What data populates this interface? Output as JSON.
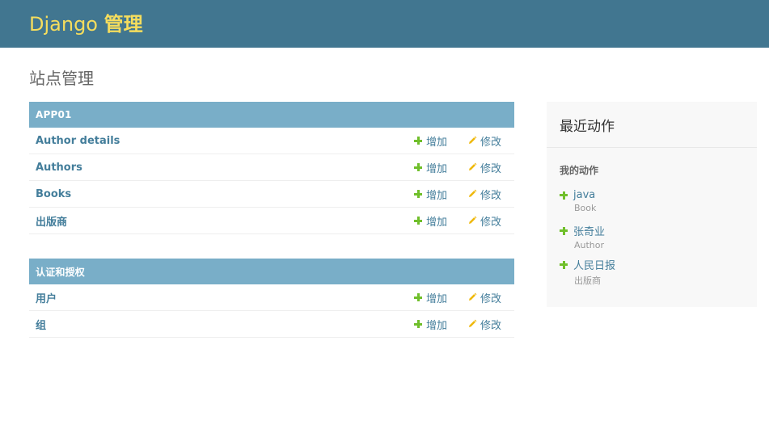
{
  "header": {
    "brand_prefix": "Django ",
    "brand_bold": "管理"
  },
  "page": {
    "title": "站点管理"
  },
  "modules": [
    {
      "caption": "APP01",
      "rows": [
        {
          "name": "Author details",
          "add": "增加",
          "change": "修改"
        },
        {
          "name": "Authors",
          "add": "增加",
          "change": "修改"
        },
        {
          "name": "Books",
          "add": "增加",
          "change": "修改"
        },
        {
          "name": "出版商",
          "add": "增加",
          "change": "修改"
        }
      ]
    },
    {
      "caption": "认证和授权",
      "rows": [
        {
          "name": "用户",
          "add": "增加",
          "change": "修改"
        },
        {
          "name": "组",
          "add": "增加",
          "change": "修改"
        }
      ]
    }
  ],
  "recent": {
    "title": "最近动作",
    "subtitle": "我的动作",
    "actions": [
      {
        "label": "java",
        "type": "Book",
        "icon": "plus-icon"
      },
      {
        "label": "张奇业",
        "type": "Author",
        "icon": "plus-icon"
      },
      {
        "label": "人民日报",
        "type": "出版商",
        "icon": "plus-icon"
      }
    ]
  },
  "colors": {
    "header_bg": "#417690",
    "brand": "#f5dd5d",
    "module_caption_bg": "#79aec8",
    "link": "#447e9b",
    "add_icon": "#70bf2b",
    "change_icon": "#efb80b",
    "sidebar_bg": "#f8f8f8"
  }
}
